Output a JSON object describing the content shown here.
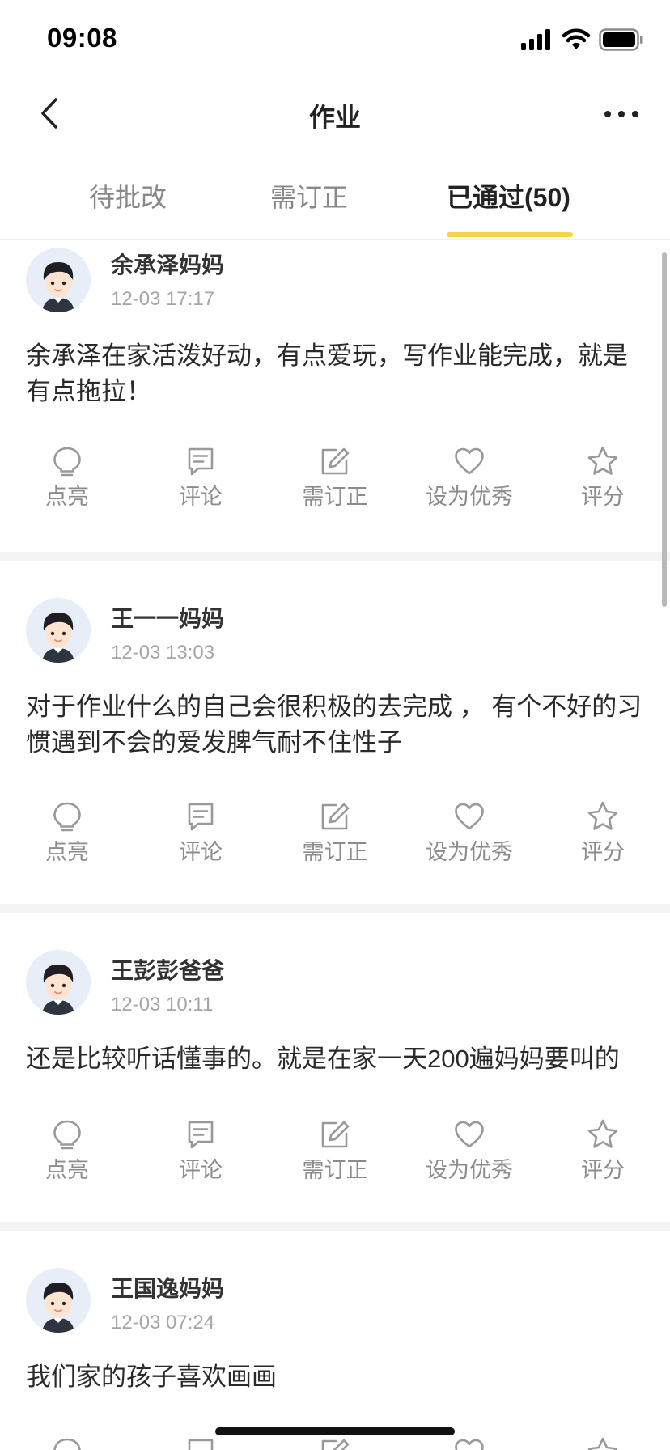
{
  "status": {
    "time": "09:08"
  },
  "nav": {
    "title": "作业"
  },
  "tabs": [
    {
      "label": "待批改",
      "active": false
    },
    {
      "label": "需订正",
      "active": false
    },
    {
      "label": "已通过(50)",
      "active": true
    }
  ],
  "colors": {
    "accent": "#f7d548",
    "icon": "#999999",
    "muted": "#a6a6a6",
    "divider": "#f2f3f5"
  },
  "action_labels": [
    "点亮",
    "评论",
    "需订正",
    "设为优秀",
    "评分"
  ],
  "action_icons": [
    "lightbulb-icon",
    "comment-icon",
    "edit-icon",
    "heart-icon",
    "star-icon"
  ],
  "posts": [
    {
      "author": "余承泽妈妈",
      "time": "12-03 17:17",
      "content": "余承泽在家活泼好动，有点爱玩，写作业能完成，就是有点拖拉！"
    },
    {
      "author": "王一一妈妈",
      "time": "12-03 13:03",
      "content": "对于作业什么的自己会很积极的去完成 ， 有个不好的习惯遇到不会的爱发脾气耐不住性子"
    },
    {
      "author": "王彭彭爸爸",
      "time": "12-03 10:11",
      "content": "还是比较听话懂事的。就是在家一天200遍妈妈要叫的"
    },
    {
      "author": "王国逸妈妈",
      "time": "12-03 07:24",
      "content": "我们家的孩子喜欢画画"
    }
  ]
}
